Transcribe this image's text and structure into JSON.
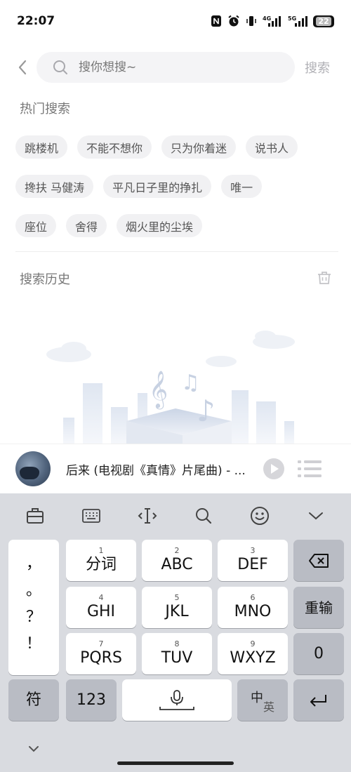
{
  "status_bar": {
    "time": "22:07",
    "battery": "22",
    "signal1": "4G",
    "signal2": "5G"
  },
  "search": {
    "placeholder": "搜你想搜~",
    "button_label": "搜索"
  },
  "hot_search": {
    "title": "热门搜索",
    "rows": [
      [
        "跳楼机",
        "不能不想你",
        "只为你着迷",
        "说书人"
      ],
      [
        "搀扶 马健涛",
        "平凡日子里的挣扎",
        "唯一"
      ],
      [
        "座位",
        "舍得",
        "烟火里的尘埃"
      ]
    ]
  },
  "history": {
    "title": "搜索历史"
  },
  "player": {
    "song_title": "后来 (电视剧《真情》片尾曲) - ..."
  },
  "keyboard": {
    "punctuation": [
      "，",
      "。",
      "？",
      "！"
    ],
    "row1": [
      {
        "num": "1",
        "label": "分词"
      },
      {
        "num": "2",
        "label": "ABC"
      },
      {
        "num": "3",
        "label": "DEF"
      }
    ],
    "row2": [
      {
        "num": "4",
        "label": "GHI"
      },
      {
        "num": "5",
        "label": "JKL"
      },
      {
        "num": "6",
        "label": "MNO"
      }
    ],
    "row3": [
      {
        "num": "7",
        "label": "PQRS"
      },
      {
        "num": "8",
        "label": "TUV"
      },
      {
        "num": "9",
        "label": "WXYZ"
      }
    ],
    "retype_label": "重输",
    "zero_label": "0",
    "symbol_label": "符",
    "numeric_label": "123",
    "lang_main": "中",
    "lang_sub": "英"
  }
}
